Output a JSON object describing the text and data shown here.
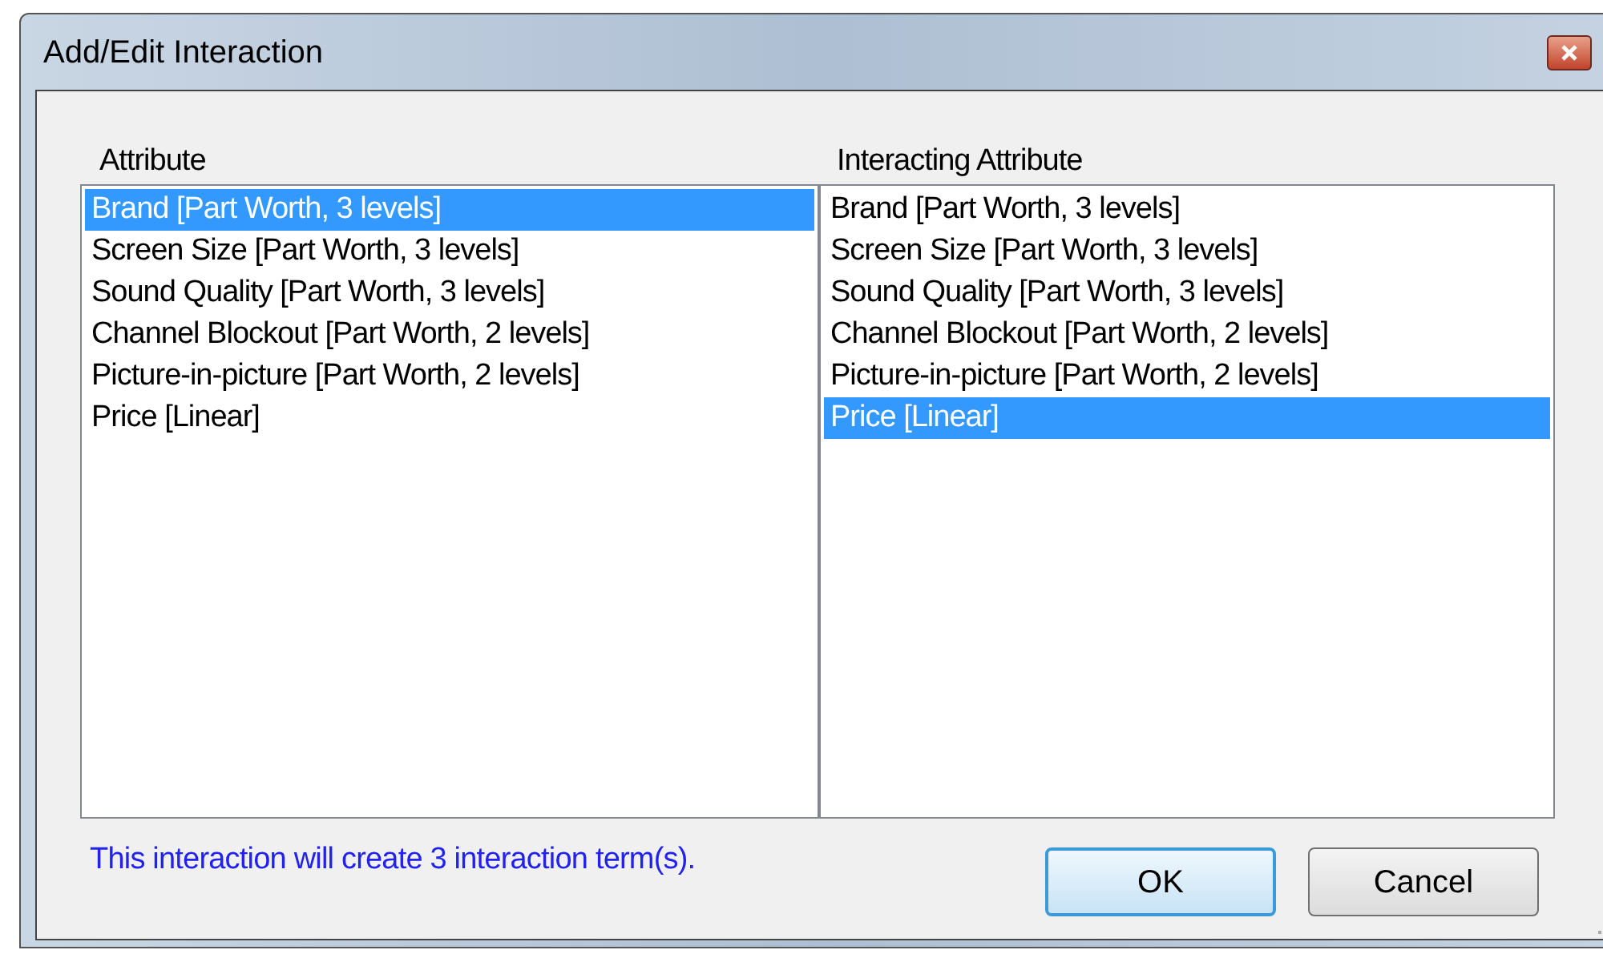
{
  "window": {
    "title": "Add/Edit Interaction"
  },
  "attribute_list": {
    "label": "Attribute",
    "items": [
      {
        "text": "Brand [Part Worth, 3 levels]",
        "selected": true
      },
      {
        "text": "Screen Size [Part Worth, 3 levels]",
        "selected": false
      },
      {
        "text": "Sound Quality [Part Worth, 3 levels]",
        "selected": false
      },
      {
        "text": "Channel Blockout [Part Worth, 2 levels]",
        "selected": false
      },
      {
        "text": "Picture-in-picture [Part Worth, 2 levels]",
        "selected": false
      },
      {
        "text": "Price [Linear]",
        "selected": false
      }
    ]
  },
  "interacting_list": {
    "label": "Interacting Attribute",
    "items": [
      {
        "text": "Brand [Part Worth, 3 levels]",
        "selected": false
      },
      {
        "text": "Screen Size [Part Worth, 3 levels]",
        "selected": false
      },
      {
        "text": "Sound Quality [Part Worth, 3 levels]",
        "selected": false
      },
      {
        "text": "Channel Blockout [Part Worth, 2 levels]",
        "selected": false
      },
      {
        "text": "Picture-in-picture [Part Worth, 2 levels]",
        "selected": false
      },
      {
        "text": "Price [Linear]",
        "selected": true
      }
    ]
  },
  "status_message": "This interaction will create 3 interaction term(s).",
  "buttons": [
    {
      "label": "OK",
      "default": true
    },
    {
      "label": "Cancel",
      "default": false
    }
  ]
}
